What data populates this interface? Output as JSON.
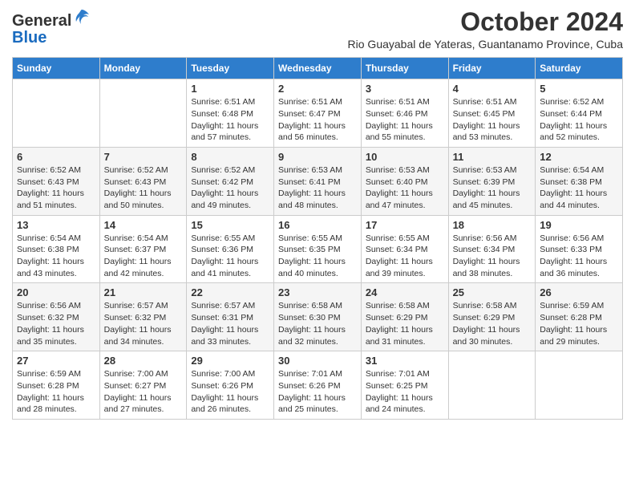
{
  "logo": {
    "general": "General",
    "blue": "Blue"
  },
  "header": {
    "title": "October 2024",
    "subtitle": "Rio Guayabal de Yateras, Guantanamo Province, Cuba"
  },
  "weekdays": [
    "Sunday",
    "Monday",
    "Tuesday",
    "Wednesday",
    "Thursday",
    "Friday",
    "Saturday"
  ],
  "weeks": [
    [
      {
        "day": "",
        "info": ""
      },
      {
        "day": "",
        "info": ""
      },
      {
        "day": "1",
        "info": "Sunrise: 6:51 AM\nSunset: 6:48 PM\nDaylight: 11 hours and 57 minutes."
      },
      {
        "day": "2",
        "info": "Sunrise: 6:51 AM\nSunset: 6:47 PM\nDaylight: 11 hours and 56 minutes."
      },
      {
        "day": "3",
        "info": "Sunrise: 6:51 AM\nSunset: 6:46 PM\nDaylight: 11 hours and 55 minutes."
      },
      {
        "day": "4",
        "info": "Sunrise: 6:51 AM\nSunset: 6:45 PM\nDaylight: 11 hours and 53 minutes."
      },
      {
        "day": "5",
        "info": "Sunrise: 6:52 AM\nSunset: 6:44 PM\nDaylight: 11 hours and 52 minutes."
      }
    ],
    [
      {
        "day": "6",
        "info": "Sunrise: 6:52 AM\nSunset: 6:43 PM\nDaylight: 11 hours and 51 minutes."
      },
      {
        "day": "7",
        "info": "Sunrise: 6:52 AM\nSunset: 6:43 PM\nDaylight: 11 hours and 50 minutes."
      },
      {
        "day": "8",
        "info": "Sunrise: 6:52 AM\nSunset: 6:42 PM\nDaylight: 11 hours and 49 minutes."
      },
      {
        "day": "9",
        "info": "Sunrise: 6:53 AM\nSunset: 6:41 PM\nDaylight: 11 hours and 48 minutes."
      },
      {
        "day": "10",
        "info": "Sunrise: 6:53 AM\nSunset: 6:40 PM\nDaylight: 11 hours and 47 minutes."
      },
      {
        "day": "11",
        "info": "Sunrise: 6:53 AM\nSunset: 6:39 PM\nDaylight: 11 hours and 45 minutes."
      },
      {
        "day": "12",
        "info": "Sunrise: 6:54 AM\nSunset: 6:38 PM\nDaylight: 11 hours and 44 minutes."
      }
    ],
    [
      {
        "day": "13",
        "info": "Sunrise: 6:54 AM\nSunset: 6:38 PM\nDaylight: 11 hours and 43 minutes."
      },
      {
        "day": "14",
        "info": "Sunrise: 6:54 AM\nSunset: 6:37 PM\nDaylight: 11 hours and 42 minutes."
      },
      {
        "day": "15",
        "info": "Sunrise: 6:55 AM\nSunset: 6:36 PM\nDaylight: 11 hours and 41 minutes."
      },
      {
        "day": "16",
        "info": "Sunrise: 6:55 AM\nSunset: 6:35 PM\nDaylight: 11 hours and 40 minutes."
      },
      {
        "day": "17",
        "info": "Sunrise: 6:55 AM\nSunset: 6:34 PM\nDaylight: 11 hours and 39 minutes."
      },
      {
        "day": "18",
        "info": "Sunrise: 6:56 AM\nSunset: 6:34 PM\nDaylight: 11 hours and 38 minutes."
      },
      {
        "day": "19",
        "info": "Sunrise: 6:56 AM\nSunset: 6:33 PM\nDaylight: 11 hours and 36 minutes."
      }
    ],
    [
      {
        "day": "20",
        "info": "Sunrise: 6:56 AM\nSunset: 6:32 PM\nDaylight: 11 hours and 35 minutes."
      },
      {
        "day": "21",
        "info": "Sunrise: 6:57 AM\nSunset: 6:32 PM\nDaylight: 11 hours and 34 minutes."
      },
      {
        "day": "22",
        "info": "Sunrise: 6:57 AM\nSunset: 6:31 PM\nDaylight: 11 hours and 33 minutes."
      },
      {
        "day": "23",
        "info": "Sunrise: 6:58 AM\nSunset: 6:30 PM\nDaylight: 11 hours and 32 minutes."
      },
      {
        "day": "24",
        "info": "Sunrise: 6:58 AM\nSunset: 6:29 PM\nDaylight: 11 hours and 31 minutes."
      },
      {
        "day": "25",
        "info": "Sunrise: 6:58 AM\nSunset: 6:29 PM\nDaylight: 11 hours and 30 minutes."
      },
      {
        "day": "26",
        "info": "Sunrise: 6:59 AM\nSunset: 6:28 PM\nDaylight: 11 hours and 29 minutes."
      }
    ],
    [
      {
        "day": "27",
        "info": "Sunrise: 6:59 AM\nSunset: 6:28 PM\nDaylight: 11 hours and 28 minutes."
      },
      {
        "day": "28",
        "info": "Sunrise: 7:00 AM\nSunset: 6:27 PM\nDaylight: 11 hours and 27 minutes."
      },
      {
        "day": "29",
        "info": "Sunrise: 7:00 AM\nSunset: 6:26 PM\nDaylight: 11 hours and 26 minutes."
      },
      {
        "day": "30",
        "info": "Sunrise: 7:01 AM\nSunset: 6:26 PM\nDaylight: 11 hours and 25 minutes."
      },
      {
        "day": "31",
        "info": "Sunrise: 7:01 AM\nSunset: 6:25 PM\nDaylight: 11 hours and 24 minutes."
      },
      {
        "day": "",
        "info": ""
      },
      {
        "day": "",
        "info": ""
      }
    ]
  ]
}
